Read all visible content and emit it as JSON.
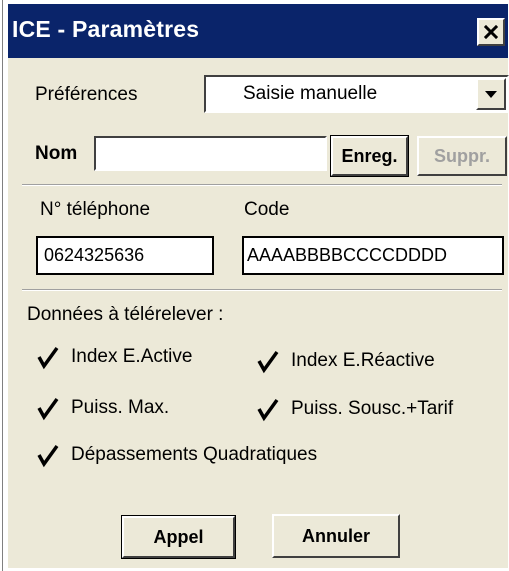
{
  "window": {
    "title": "ICE - Paramètres"
  },
  "preferences": {
    "label": "Préférences",
    "selected": "Saisie manuelle"
  },
  "nom": {
    "label": "Nom",
    "value": "",
    "save_label": "Enreg.",
    "delete_label": "Suppr."
  },
  "phone": {
    "label": "N° téléphone",
    "value": "0624325636"
  },
  "code": {
    "label": "Code",
    "value": "AAAABBBBCCCCDDDD"
  },
  "data_section": {
    "label": "Données à télérelever :",
    "options": [
      {
        "label": "Index E.Active",
        "checked": true
      },
      {
        "label": "Index E.Réactive",
        "checked": true
      },
      {
        "label": "Puiss. Max.",
        "checked": true
      },
      {
        "label": "Puiss. Sousc.+Tarif",
        "checked": true
      },
      {
        "label": "Dépassements Quadratiques",
        "checked": true
      }
    ]
  },
  "actions": {
    "call_label": "Appel",
    "cancel_label": "Annuler"
  },
  "colors": {
    "titlebar": "#0a246a",
    "dialog": "#ece9d8",
    "disabled_text": "#a0a0a0"
  },
  "icons": {
    "close": "close-icon",
    "dropdown": "chevron-down-icon",
    "check": "checkmark-icon"
  }
}
